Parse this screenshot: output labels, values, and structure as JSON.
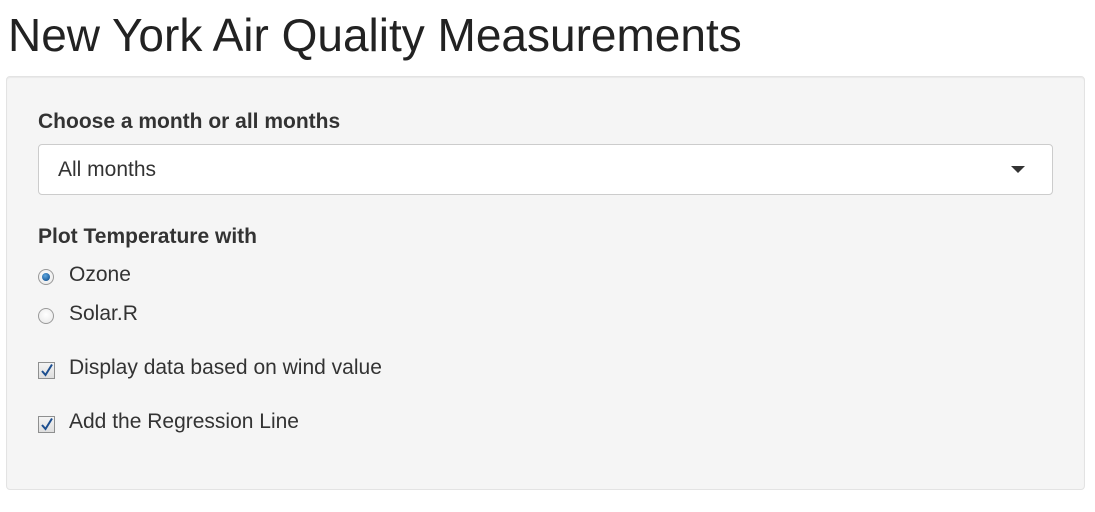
{
  "page": {
    "title": "New York Air Quality Measurements"
  },
  "month_select": {
    "label": "Choose a month or all months",
    "selected": "All months"
  },
  "plot_with": {
    "label": "Plot Temperature with",
    "options": [
      {
        "label": "Ozone",
        "checked": true
      },
      {
        "label": "Solar.R",
        "checked": false
      }
    ]
  },
  "checkboxes": [
    {
      "label": "Display data based on wind value",
      "checked": true
    },
    {
      "label": "Add the Regression Line",
      "checked": true
    }
  ],
  "colors": {
    "panel_bg": "#f5f5f5",
    "check_color": "#1c4e8f",
    "radio_accent": "#1e5f9e"
  }
}
